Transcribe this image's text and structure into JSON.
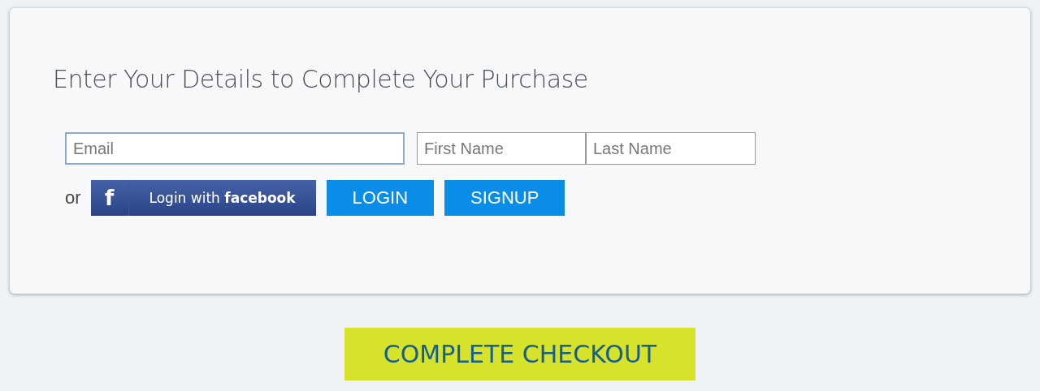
{
  "card": {
    "title": "Enter Your Details to Complete Your Purchase",
    "fields": [
      {
        "placeholder": "Email",
        "focused": true
      },
      {
        "placeholder": "First Name",
        "focused": false
      },
      {
        "placeholder": "Last Name",
        "focused": false
      }
    ],
    "or_text": "or",
    "facebook_button": {
      "glyph": "f",
      "label": "Login with **facebook**"
    },
    "buttons": [
      "LOGIN",
      "SIGNUP"
    ]
  },
  "checkout_button": "COMPLETE CHECKOUT"
}
